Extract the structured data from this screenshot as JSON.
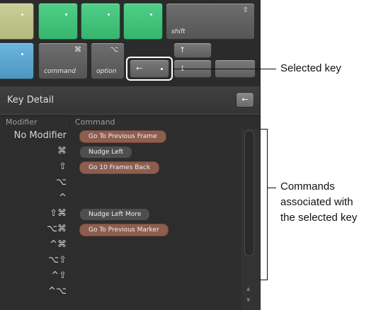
{
  "keyboard": {
    "keys": [
      {
        "label": "shift",
        "symbol": "⇧"
      },
      {
        "label": "command",
        "symbol": "⌘"
      },
      {
        "label": "option",
        "symbol": "⌥"
      },
      {
        "symbol": "↑"
      },
      {
        "symbol": "↓"
      },
      {
        "symbol": "←"
      }
    ]
  },
  "panel": {
    "title": "Key Detail",
    "header_button_symbol": "←",
    "columns": {
      "modifier": "Modifier",
      "command": "Command"
    },
    "rows": [
      {
        "modifier": "No Modifier",
        "command": "Go To Previous Frame",
        "style": "brown"
      },
      {
        "modifier": "⌘",
        "command": "Nudge Left",
        "style": "dark"
      },
      {
        "modifier": "⇧",
        "command": "Go 10 Frames Back",
        "style": "brown"
      },
      {
        "modifier": "⌥",
        "command": "",
        "style": ""
      },
      {
        "modifier": "^",
        "command": "",
        "style": ""
      },
      {
        "modifier": "⇧⌘",
        "command": "Nudge Left More",
        "style": "dark"
      },
      {
        "modifier": "⌥⌘",
        "command": "Go To Previous Marker",
        "style": "brown"
      },
      {
        "modifier": "^⌘",
        "command": "",
        "style": ""
      },
      {
        "modifier": "⌥⇧",
        "command": "",
        "style": ""
      },
      {
        "modifier": "^⇧",
        "command": "",
        "style": ""
      },
      {
        "modifier": "^⌥",
        "command": "",
        "style": ""
      }
    ]
  },
  "callouts": {
    "selected_key": "Selected key",
    "commands_line1": "Commands",
    "commands_line2": "associated with",
    "commands_line3": "the selected key"
  },
  "colors": {
    "brown_pill": "#8d5e4f",
    "dark_pill": "#4e4e4e",
    "green_key": "#36b56f",
    "blue_key": "#4d97c3",
    "yellow_key": "#b4b97e"
  }
}
